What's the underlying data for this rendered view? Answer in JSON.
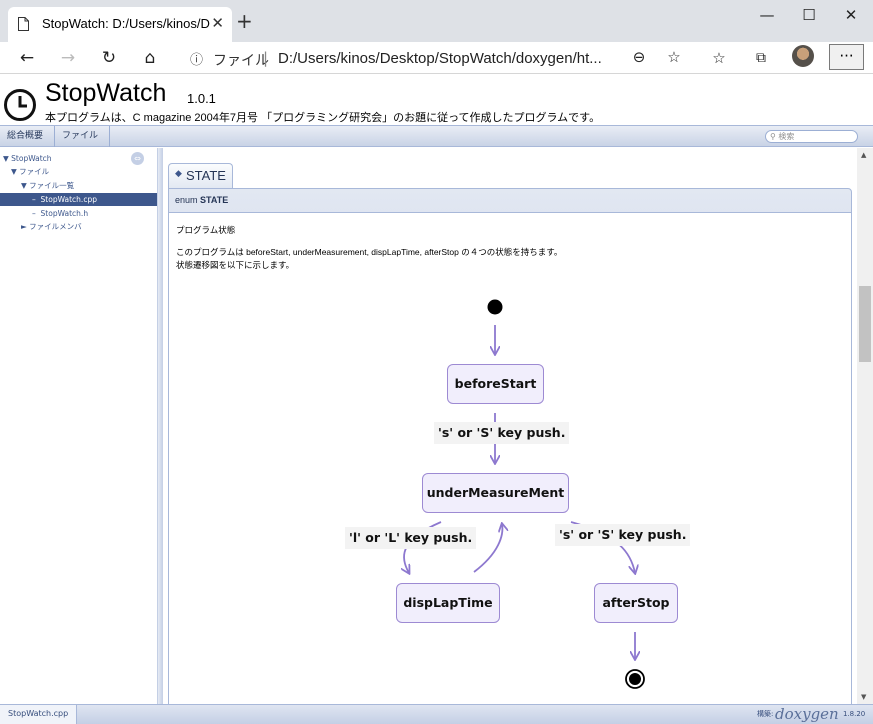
{
  "browser": {
    "tab_title": "StopWatch: D:/Users/kinos/Desktop/StopWatch/doxygen/html",
    "new_tab_glyph": "+",
    "address_label": "ファイル",
    "address_separator": "|",
    "url": "D:/Users/kinos/Desktop/StopWatch/doxygen/ht...",
    "more_glyph": "···"
  },
  "header": {
    "project_name": "StopWatch",
    "version": "1.0.1",
    "brief": "本プログラムは、C magazine 2004年7月号 「プログラミング研究会」のお題に従って作成したプログラムです。"
  },
  "menu": {
    "items": [
      "総合概要",
      "ファイル ▾"
    ],
    "search_placeholder": "検索"
  },
  "tree": {
    "items": [
      {
        "label": "▼ StopWatch"
      },
      {
        "label": "▼ ファイル"
      },
      {
        "label": "▼ ファイル一覧"
      },
      {
        "label": "StopWatch.cpp",
        "selected": true
      },
      {
        "label": "StopWatch.h"
      },
      {
        "label": "► ファイルメンバ"
      }
    ]
  },
  "doc": {
    "member_title": "STATE",
    "proto_prefix": "enum",
    "proto_name": "STATE",
    "lines": [
      "プログラム状態",
      "このプログラムは beforeStart, underMeasurement, dispLapTime, afterStop の４つの状態を持ちます。",
      "状態遷移図を以下に示します。"
    ]
  },
  "diagram": {
    "states": [
      "beforeStart",
      "underMeasureMent",
      "dispLapTime",
      "afterStop"
    ],
    "transitions": [
      "'s' or 'S' key push.",
      "'l' or 'L' key push.",
      "'s' or 'S' key push."
    ],
    "colors": {
      "state_fill": "#f1eefc",
      "state_border": "#9d8ad3",
      "arrow": "#8d78cf"
    }
  },
  "footer": {
    "breadcrumb": "StopWatch.cpp",
    "generated_by": "構築:",
    "logo": "doxygen",
    "version": "1.8.20"
  },
  "icons": [
    "page-icon",
    "close-icon",
    "back-icon",
    "forward-icon",
    "refresh-icon",
    "home-icon",
    "info-icon",
    "zoom-icon",
    "star-icon",
    "favorites-icon",
    "collections-icon",
    "clock-icon",
    "sync-icon"
  ]
}
